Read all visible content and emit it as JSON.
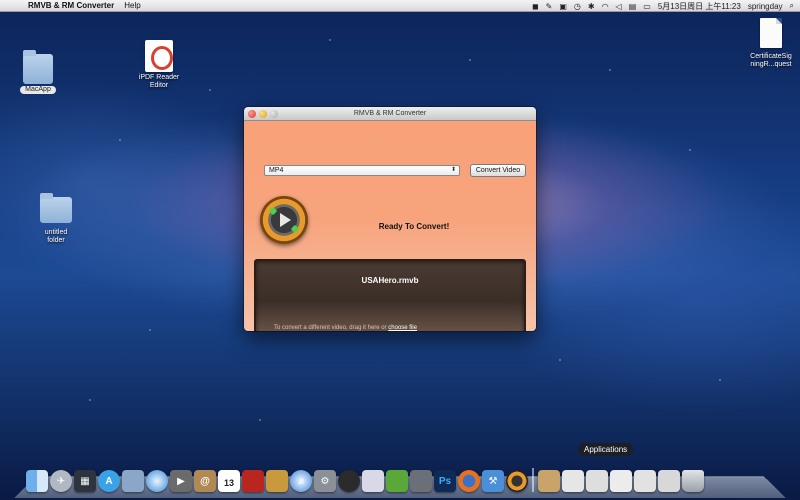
{
  "menubar": {
    "app_name": "RMVB & RM Converter",
    "help": "Help",
    "datetime": "5月13日周日 上午11:23",
    "user": "springday"
  },
  "desktop": {
    "macapp": "MacApp",
    "ipdf_line1": "iPDF Reader",
    "ipdf_line2": "Editor",
    "untitled_line1": "untitled",
    "untitled_line2": "folder",
    "cert_line1": "CertificateSig",
    "cert_line2": "ningR...quest"
  },
  "window": {
    "title": "RMVB & RM Converter",
    "format_value": "MP4",
    "convert_label": "Convert Video",
    "status": "Ready To Convert!",
    "filename": "USAHero.rmvb",
    "hint_prefix": "To convert a different video, drag it here or ",
    "hint_link": "choose file"
  },
  "dock": {
    "tooltip": "Applications",
    "calendar_day": "13",
    "photoshop": "Ps"
  },
  "colors": {
    "window_bg": "#f9a27a",
    "drop_bg": "#3b2e28"
  }
}
